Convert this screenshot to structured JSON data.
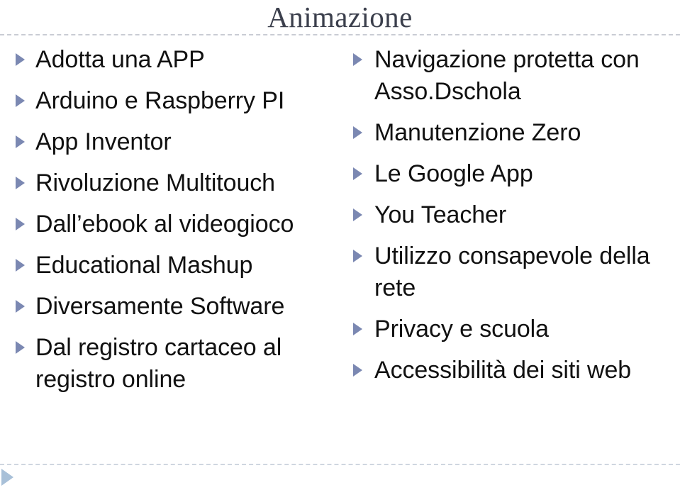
{
  "slide": {
    "title": "Animazione",
    "title_color": "#3b3f4c",
    "background_color": "#ffffff",
    "bullet_marker_color": "#7b88b2",
    "divider_color": "#c9ccd4",
    "nav_arrow_color": "#a8c0d8"
  },
  "columns": {
    "left": {
      "items": [
        {
          "text": "Adotta una APP"
        },
        {
          "text": "Arduino e Raspberry PI"
        },
        {
          "text": "App Inventor"
        },
        {
          "text": "Rivoluzione Multitouch"
        },
        {
          "text": "Dall’ebook al videogioco"
        },
        {
          "text": "Educational Mashup"
        },
        {
          "text": "Diversamente Software"
        },
        {
          "text": "Dal registro cartaceo al registro online"
        }
      ]
    },
    "right": {
      "items": [
        {
          "text": "Navigazione protetta con Asso.Dschola"
        },
        {
          "text": "Manutenzione Zero"
        },
        {
          "text": "Le Google App"
        },
        {
          "text": "You Teacher"
        },
        {
          "text": "Utilizzo consapevole della rete"
        },
        {
          "text": "Privacy e scuola"
        },
        {
          "text": "Accessibilità dei siti web"
        }
      ]
    }
  },
  "footer": {
    "nav_icon": "play-triangle-icon"
  }
}
